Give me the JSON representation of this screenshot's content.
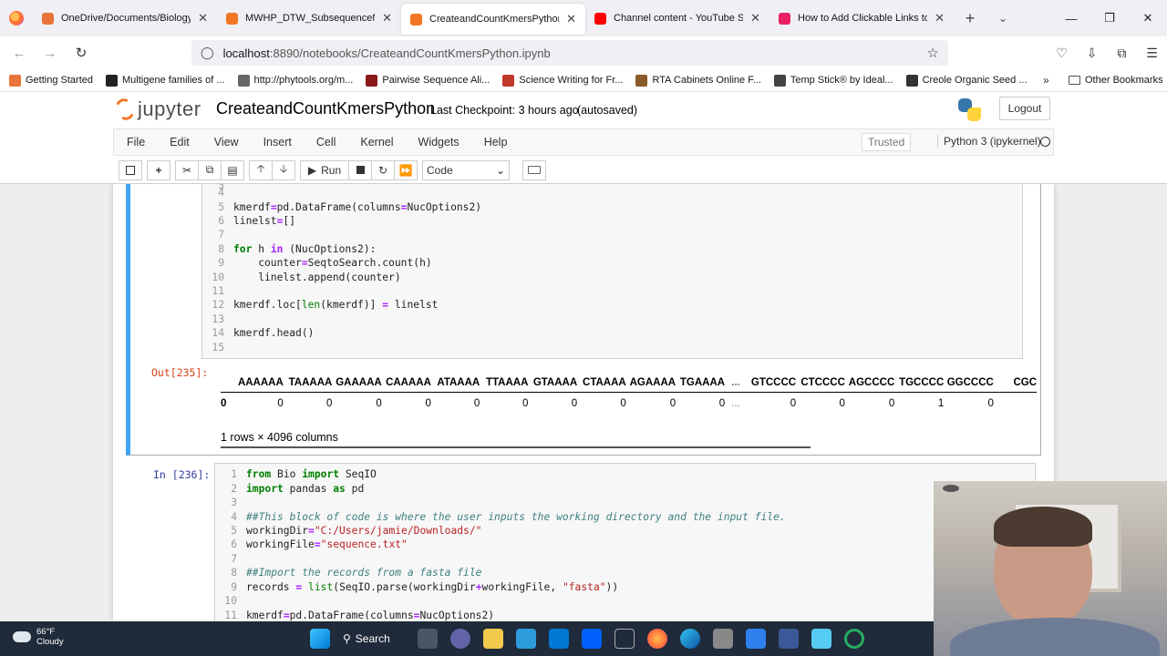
{
  "browser": {
    "tabs": [
      {
        "title": "OneDrive/Documents/Biology P",
        "fav_color": "#e8743b"
      },
      {
        "title": "MWHP_DTW_SubsequenceMatc",
        "fav_color": "#f37626"
      },
      {
        "title": "CreateandCountKmersPython - ",
        "fav_color": "#f37626"
      },
      {
        "title": "Channel content - YouTube Stud",
        "fav_color": "#ff0000"
      },
      {
        "title": "How to Add Clickable Links to Y",
        "fav_color": "#e91e63"
      }
    ],
    "url_host": "localhost",
    "url_path": ":8890/notebooks/CreateandCountKmersPython.ipynb",
    "bookmarks": [
      {
        "label": "Getting Started",
        "color": "#e8743b"
      },
      {
        "label": "Multigene families of ...",
        "color": "#222222"
      },
      {
        "label": "http://phytools.org/m...",
        "color": "#666666"
      },
      {
        "label": "Pairwise Sequence Ali...",
        "color": "#8b1a1a"
      },
      {
        "label": "Science Writing for Fr...",
        "color": "#c0392b"
      },
      {
        "label": "RTA Cabinets Online F...",
        "color": "#8b5a2b"
      },
      {
        "label": "Temp Stick® by Ideal...",
        "color": "#444444"
      },
      {
        "label": "Creole Organic Seed ...",
        "color": "#333333"
      }
    ],
    "other_bookmarks": "Other Bookmarks"
  },
  "jupyter": {
    "logo_text": "jupyter",
    "notebook_title": "CreateandCountKmersPython",
    "checkpoint": "Last Checkpoint: 3 hours ago",
    "autosave": "(autosaved)",
    "logout": "Logout",
    "menu": [
      "File",
      "Edit",
      "View",
      "Insert",
      "Cell",
      "Kernel",
      "Widgets",
      "Help"
    ],
    "trusted": "Trusted",
    "kernel": "Python 3 (ipykernel)",
    "run_label": "Run",
    "cell_type": "Code"
  },
  "cell1": {
    "out_prompt": "Out[235]:",
    "columns": [
      "AAAAAA",
      "TAAAAA",
      "GAAAAA",
      "CAAAAA",
      "ATAAAA",
      "TTAAAA",
      "GTAAAA",
      "CTAAAA",
      "AGAAAA",
      "TGAAAA",
      "...",
      "GTCCCC",
      "CTCCCC",
      "AGCCCC",
      "TGCCCC",
      "GGCCCC",
      "CGC"
    ],
    "row_index": "0",
    "row_values": [
      "0",
      "0",
      "0",
      "0",
      "0",
      "0",
      "0",
      "0",
      "0",
      "0",
      "...",
      "0",
      "0",
      "0",
      "1",
      "0",
      ""
    ],
    "shape": "1 rows × 4096 columns"
  },
  "cell2": {
    "in_prompt": "In [236]:"
  },
  "taskbar": {
    "temp": "66°F",
    "weather": "Cloudy",
    "search": "Search"
  }
}
